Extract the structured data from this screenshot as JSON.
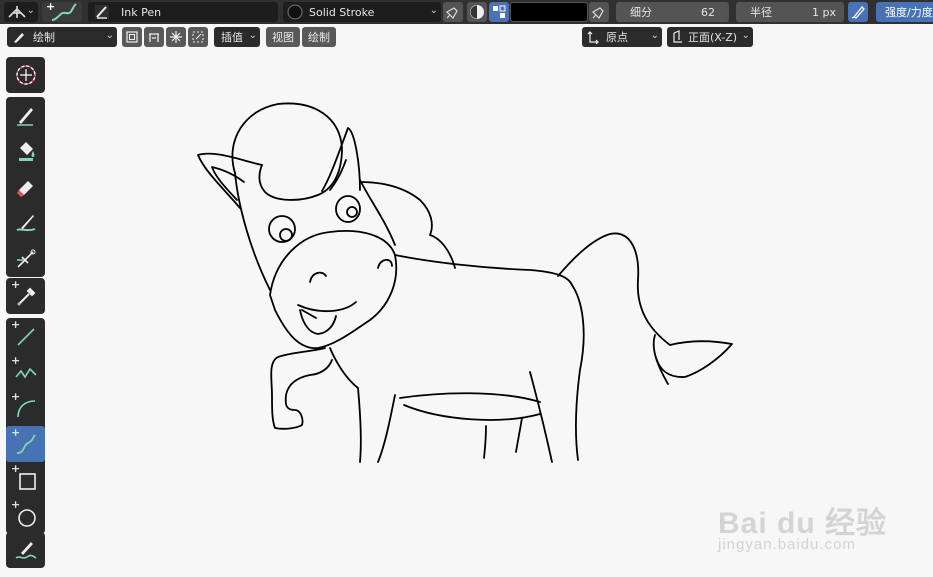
{
  "header": {
    "editor_type_icon": "editor-type-icon",
    "active_tool_icon": "ink-pen-tool-icon",
    "brush_name": "Ink Pen",
    "material_name": "Solid Stroke",
    "subdivision": {
      "label": "细分",
      "value": "62"
    },
    "radius": {
      "label": "半径",
      "value": "1 px"
    },
    "strength_label": "强度/力度",
    "color_swatch": "#000000"
  },
  "subheader": {
    "mode": "绘制",
    "interpolate": "插值",
    "view": "视图",
    "draw": "绘制",
    "origin": "原点",
    "orientation": "正面(X-Z)"
  },
  "toolbar": {
    "tools": [
      "cursor",
      "draw",
      "fill",
      "erase",
      "tint",
      "cutter",
      "eyedropper",
      "line",
      "polyline",
      "arc",
      "curve",
      "box",
      "circle",
      "annotate"
    ],
    "active": "curve"
  },
  "colors": {
    "header_bg": "#303030",
    "toolbar_bg": "#2b2b2b",
    "active_blue": "#4772b3",
    "canvas_bg": "#f7f7f7",
    "tool_accent": "#7fd9b0"
  },
  "watermark": {
    "logo": "Bai du 经验",
    "url": "jingyan.baidu.com"
  }
}
